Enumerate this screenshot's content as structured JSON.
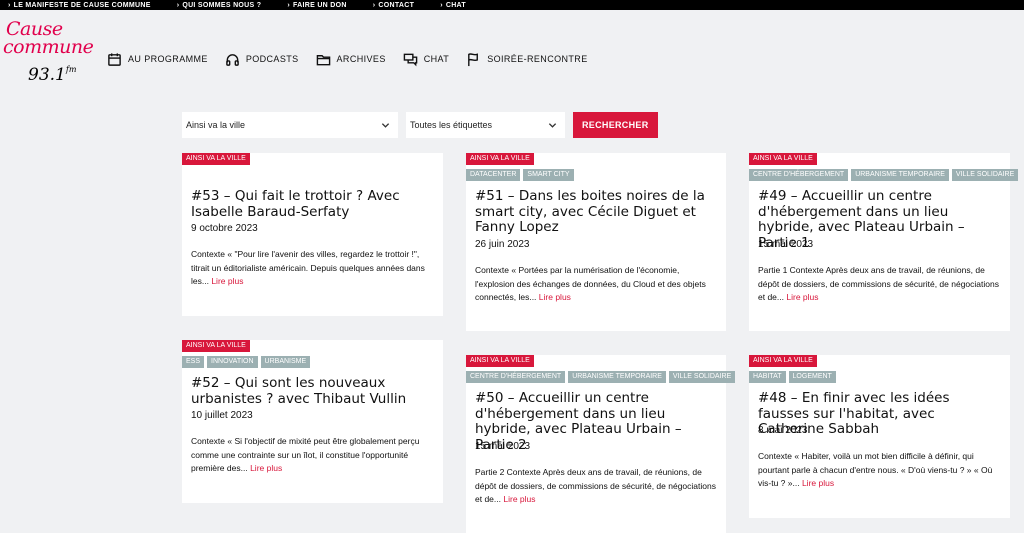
{
  "topbar": {
    "items": [
      "LE MANIFESTE DE CAUSE COMMUNE",
      "QUI SOMMES NOUS ?",
      "FAIRE UN DON",
      "CONTACT",
      "CHAT"
    ]
  },
  "logo": {
    "line1": "Cause",
    "line2": "commune",
    "freq": "93.1",
    "fm": "fm"
  },
  "nav": {
    "items": [
      {
        "label": "AU PROGRAMME",
        "icon": "calendar-icon"
      },
      {
        "label": "PODCASTS",
        "icon": "headphones-icon"
      },
      {
        "label": "ARCHIVES",
        "icon": "folder-icon"
      },
      {
        "label": "CHAT",
        "icon": "chat-icon"
      },
      {
        "label": "SOIRÉE-RENCONTRE",
        "icon": "flag-icon"
      }
    ]
  },
  "filters": {
    "show": "Ainsi va la ville",
    "tags": "Toutes les étiquettes",
    "search": "RECHERCHER"
  },
  "more_label": "Lire plus",
  "cards": [
    {
      "category": "AINSI VA LA VILLE",
      "tags": [],
      "title": "#53 – Qui fait le trottoir ? Avec Isabelle Baraud-Serfaty",
      "date": "9 octobre 2023",
      "excerpt": "Contexte « \"Pour lire l'avenir des villes, regardez le trottoir !\", titrait un éditorialiste américain. Depuis quelques années dans les..."
    },
    {
      "category": "AINSI VA LA VILLE",
      "tags": [
        "DATACENTER",
        "SMART CITY"
      ],
      "title": "#51 – Dans les boites noires de la smart city, avec Cécile Diguet et Fanny Lopez",
      "date": "26 juin 2023",
      "excerpt": "Contexte « Portées par la numérisation de l'économie, l'explosion des échanges de données, du Cloud et des objets connectés, les..."
    },
    {
      "category": "AINSI VA LA VILLE",
      "tags": [
        "CENTRE D'HÉBERGEMENT",
        "URBANISME TEMPORAIRE",
        "VILLE SOLIDAIRE"
      ],
      "title": "#49 – Accueillir un centre d'hébergement dans un lieu hybride, avec Plateau Urbain – Partie 1",
      "date": "15 mai 2023",
      "excerpt": "Partie 1 Contexte Après deux ans de travail, de réunions, de dépôt de dossiers, de commissions de sécurité, de négociations et de..."
    },
    {
      "category": "AINSI VA LA VILLE",
      "tags": [
        "ESS",
        "INNOVATION",
        "URBANISME"
      ],
      "title": "#52 – Qui sont les nouveaux urbanistes ? avec Thibaut Vullin",
      "date": "10 juillet 2023",
      "excerpt": "Contexte « Si l'objectif de mixité peut être globalement perçu comme une contrainte sur un îlot, il constitue l'opportunité première des..."
    },
    {
      "category": "AINSI VA LA VILLE",
      "tags": [
        "CENTRE D'HÉBERGEMENT",
        "URBANISME TEMPORAIRE",
        "VILLE SOLIDAIRE"
      ],
      "title": "#50 – Accueillir un centre d'hébergement dans un lieu hybride, avec Plateau Urbain – Partie 2",
      "date": "15 mai 2023",
      "excerpt": "Partie 2 Contexte Après deux ans de travail, de réunions, de dépôt de dossiers, de commissions de sécurité, de négociations et de..."
    },
    {
      "category": "AINSI VA LA VILLE",
      "tags": [
        "HABITAT",
        "LOGEMENT"
      ],
      "title": "#48 – En finir avec les idées fausses sur l'habitat, avec Catherine Sabbah",
      "date": "8 mai 2023",
      "excerpt": "Contexte « Habiter, voilà un mot bien difficile à définir, qui pourtant parle à chacun d'entre nous. « D'où viens-tu ? » « Où vis-tu ? »..."
    }
  ],
  "colors": {
    "accent": "#d8173b",
    "tag": "#9cb0b2",
    "logo": "#e1004c"
  }
}
